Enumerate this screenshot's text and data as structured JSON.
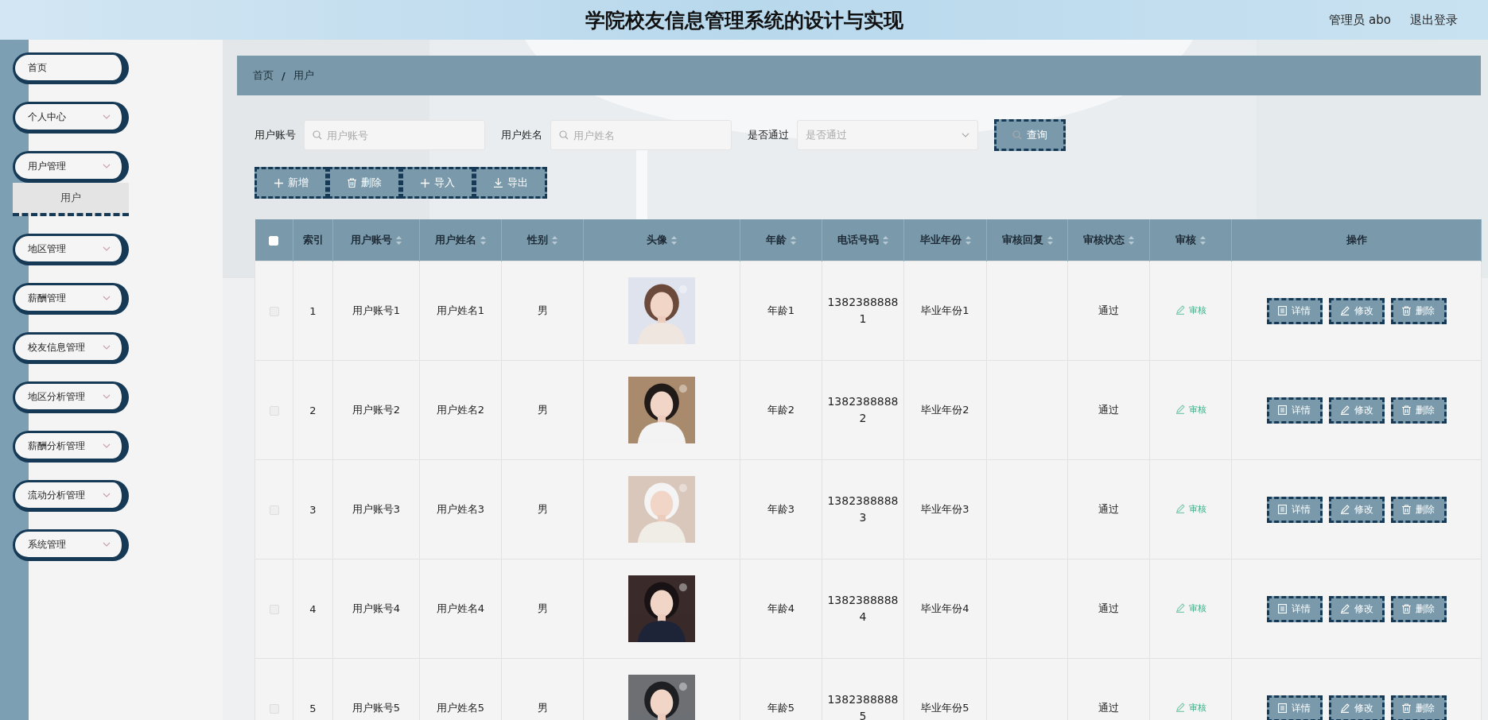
{
  "header": {
    "title": "学院校友信息管理系统的设计与实现",
    "user": "管理员 abo",
    "logout": "退出登录"
  },
  "sidebar": {
    "items": [
      {
        "label": "首页",
        "kind": "link",
        "expanded": false
      },
      {
        "label": "个人中心",
        "kind": "submenu",
        "expanded": false
      },
      {
        "label": "用户管理",
        "kind": "submenu",
        "expanded": true,
        "children": [
          {
            "label": "用户",
            "selected": true
          }
        ]
      },
      {
        "label": "地区管理",
        "kind": "submenu",
        "expanded": false
      },
      {
        "label": "薪酬管理",
        "kind": "submenu",
        "expanded": false
      },
      {
        "label": "校友信息管理",
        "kind": "submenu",
        "expanded": false
      },
      {
        "label": "地区分析管理",
        "kind": "submenu",
        "expanded": false
      },
      {
        "label": "薪酬分析管理",
        "kind": "submenu",
        "expanded": false
      },
      {
        "label": "流动分析管理",
        "kind": "submenu",
        "expanded": false
      },
      {
        "label": "系统管理",
        "kind": "submenu",
        "expanded": false
      }
    ]
  },
  "breadcrumb": {
    "items": [
      "首页",
      "用户"
    ],
    "separator": "/"
  },
  "filters": [
    {
      "kind": "input",
      "label": "用户账号",
      "placeholder": "用户账号"
    },
    {
      "kind": "input",
      "label": "用户姓名",
      "placeholder": "用户姓名"
    },
    {
      "kind": "select",
      "label": "是否通过",
      "placeholder": "是否通过"
    }
  ],
  "search_button": "查询",
  "actions": [
    {
      "kind": "plus",
      "label": "新增"
    },
    {
      "kind": "trash",
      "label": "删除"
    },
    {
      "kind": "plus",
      "label": "导入"
    },
    {
      "kind": "download",
      "label": "导出"
    }
  ],
  "table": {
    "select_all_checked": false,
    "columns": [
      {
        "label": "索引",
        "sortable": false
      },
      {
        "label": "用户账号",
        "sortable": true
      },
      {
        "label": "用户姓名",
        "sortable": true
      },
      {
        "label": "性别",
        "sortable": true
      },
      {
        "label": "头像",
        "sortable": true
      },
      {
        "label": "年龄",
        "sortable": true
      },
      {
        "label": "电话号码",
        "sortable": true
      },
      {
        "label": "毕业年份",
        "sortable": true
      },
      {
        "label": "审核回复",
        "sortable": true
      },
      {
        "label": "审核状态",
        "sortable": true
      },
      {
        "label": "审核",
        "sortable": true
      },
      {
        "label": "操作",
        "sortable": false
      }
    ],
    "rows": [
      {
        "checked": false,
        "index": "1",
        "account": "用户账号1",
        "name": "用户姓名1",
        "gender": "男",
        "age": "年龄1",
        "phone": "13823888881",
        "grad_year": "毕业年份1",
        "status": "通过",
        "review": "审核",
        "actions": [
          {
            "kind": "detail",
            "label": "详情"
          },
          {
            "kind": "edit",
            "label": "修改"
          },
          {
            "kind": "trash",
            "label": "删除"
          }
        ]
      },
      {
        "checked": false,
        "index": "2",
        "account": "用户账号2",
        "name": "用户姓名2",
        "gender": "男",
        "age": "年龄2",
        "phone": "13823888882",
        "grad_year": "毕业年份2",
        "status": "通过",
        "review": "审核",
        "actions": [
          {
            "kind": "detail",
            "label": "详情"
          },
          {
            "kind": "edit",
            "label": "修改"
          },
          {
            "kind": "trash",
            "label": "删除"
          }
        ]
      },
      {
        "checked": false,
        "index": "3",
        "account": "用户账号3",
        "name": "用户姓名3",
        "gender": "男",
        "age": "年龄3",
        "phone": "13823888883",
        "grad_year": "毕业年份3",
        "status": "通过",
        "review": "审核",
        "actions": [
          {
            "kind": "detail",
            "label": "详情"
          },
          {
            "kind": "edit",
            "label": "修改"
          },
          {
            "kind": "trash",
            "label": "删除"
          }
        ]
      },
      {
        "checked": false,
        "index": "4",
        "account": "用户账号4",
        "name": "用户姓名4",
        "gender": "男",
        "age": "年龄4",
        "phone": "13823888884",
        "grad_year": "毕业年份4",
        "status": "通过",
        "review": "审核",
        "actions": [
          {
            "kind": "detail",
            "label": "详情"
          },
          {
            "kind": "edit",
            "label": "修改"
          },
          {
            "kind": "trash",
            "label": "删除"
          }
        ]
      },
      {
        "checked": false,
        "index": "5",
        "account": "用户账号5",
        "name": "用户姓名5",
        "gender": "男",
        "age": "年龄5",
        "phone": "13823888885",
        "grad_year": "毕业年份5",
        "status": "通过",
        "review": "审核",
        "actions": [
          {
            "kind": "detail",
            "label": "详情"
          },
          {
            "kind": "edit",
            "label": "修改"
          },
          {
            "kind": "trash",
            "label": "删除"
          }
        ]
      }
    ]
  }
}
